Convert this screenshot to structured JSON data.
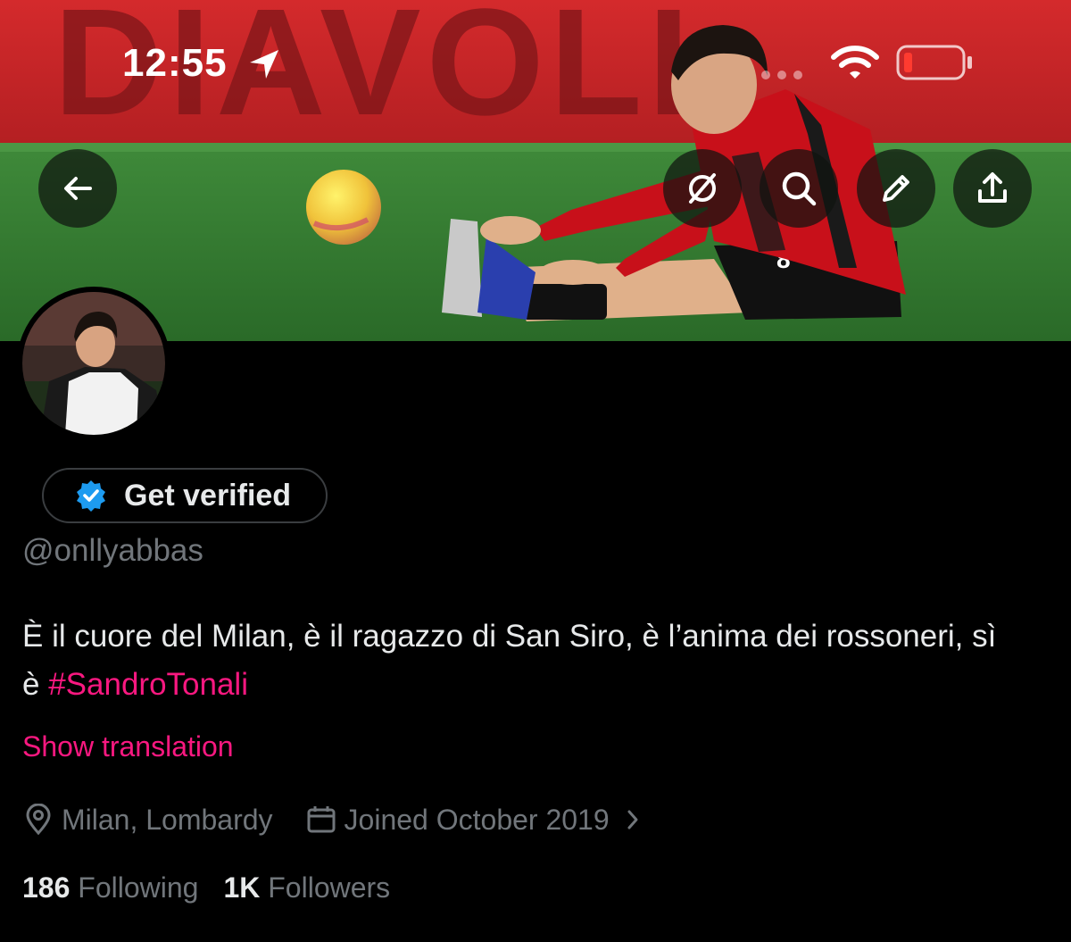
{
  "status_bar": {
    "time": "12:55"
  },
  "banner": {
    "wall_text": "DIAVOLI",
    "jersey_number": "8"
  },
  "profile": {
    "get_verified_label": "Get verified",
    "handle": "@onllyabbas",
    "bio_text": "È il cuore del Milan, è il ragazzo di San Siro, è l’anima dei rossoneri, sì è ",
    "bio_hashtag": "#SandroTonali",
    "show_translation": "Show translation",
    "location": "Milan, Lombardy",
    "joined": "Joined October 2019",
    "following_count": "186",
    "following_label": "Following",
    "followers_count": "1K",
    "followers_label": "Followers"
  },
  "icons": {
    "back": "arrow-left-icon",
    "grok": "grok-icon",
    "search": "search-icon",
    "edit": "pencil-icon",
    "share": "share-icon",
    "verified": "verified-badge-icon",
    "location": "location-pin-icon",
    "calendar": "calendar-icon",
    "chevron": "chevron-right-icon"
  },
  "colors": {
    "accent": "#f91880",
    "verified_blue": "#1d9bf0",
    "muted_text": "#71767b",
    "battery_low": "#ff3b30"
  }
}
